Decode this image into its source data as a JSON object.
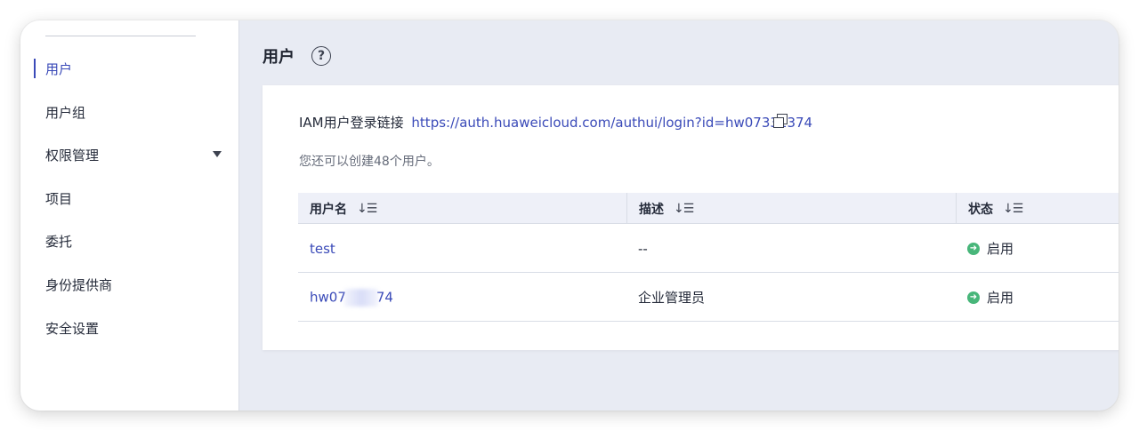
{
  "sidebar": {
    "items": [
      {
        "label": "用户",
        "active": true
      },
      {
        "label": "用户组"
      },
      {
        "label": "权限管理",
        "expandable": true
      },
      {
        "label": "项目"
      },
      {
        "label": "委托"
      },
      {
        "label": "身份提供商"
      },
      {
        "label": "安全设置"
      }
    ]
  },
  "header": {
    "title": "用户",
    "help_icon": "question-circle-icon"
  },
  "card": {
    "login_label": "IAM用户登录链接",
    "login_url": "https://auth.huaweicloud.com/authui/login?id=hw07331374",
    "quota_text": "您还可以创建48个用户。"
  },
  "table": {
    "columns": [
      "用户名",
      "描述",
      "状态"
    ],
    "sort_icon": "↓☰",
    "rows": [
      {
        "username": "test",
        "description": "--",
        "status": "启用"
      },
      {
        "username_prefix": "hw07",
        "username_suffix": "74",
        "description": "企业管理员",
        "status": "启用"
      }
    ]
  },
  "colors": {
    "accent": "#3a4ab8",
    "status_enabled": "#48b67a",
    "background": "#e8ebf3"
  }
}
